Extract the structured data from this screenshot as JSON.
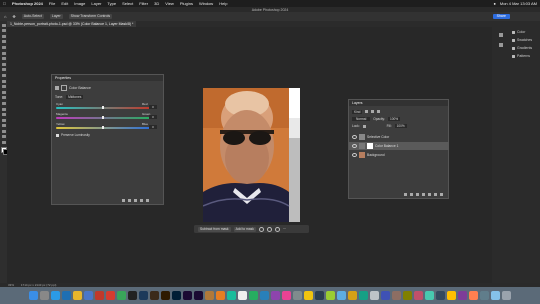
{
  "menubar": {
    "app": "Photoshop 2024",
    "items": [
      "File",
      "Edit",
      "Image",
      "Layer",
      "Type",
      "Select",
      "Filter",
      "3D",
      "View",
      "Plugins",
      "Window",
      "Help"
    ],
    "datetime": "Mon 4 Mar 13:03 AM"
  },
  "window": {
    "title": "Adobe Photoshop 2024"
  },
  "options": {
    "auto_select": "Auto-Select",
    "layer": "Layer",
    "show_transform": "Show Transform Controls",
    "share": "Share"
  },
  "document": {
    "tab": "1_Noble-person_portrait-photo-1.psd @ 33% (Color Balance 1, Layer Mask/8) *"
  },
  "dock_right": {
    "items": [
      "Color",
      "Swatches",
      "Gradients",
      "Patterns"
    ]
  },
  "properties": {
    "title": "Properties",
    "subtitle": "Color Balance",
    "tone_label": "Tone:",
    "tone_value": "Midtones",
    "sliders": [
      {
        "left": "Cyan",
        "right": "Red",
        "value": "0",
        "pos": 0.5,
        "color": "#c0392b"
      },
      {
        "left": "Magenta",
        "right": "Green",
        "value": "0",
        "pos": 0.5,
        "color": "#27ae60"
      },
      {
        "left": "Yellow",
        "right": "Blue",
        "value": "0",
        "pos": 0.5,
        "color": "#2e6fd8"
      }
    ],
    "preserve": "Preserve Luminosity"
  },
  "context": {
    "subtract": "Subtract from mask",
    "add": "Add to mask"
  },
  "layers": {
    "title": "Layers",
    "kind": "Kind",
    "blend": "Normal",
    "opacity_label": "Opacity:",
    "opacity": "100%",
    "lock_label": "Lock:",
    "fill_label": "Fill:",
    "fill": "100%",
    "rows": [
      {
        "name": "Selective Color"
      },
      {
        "name": "Color Balance 1"
      },
      {
        "name": "Background"
      }
    ]
  },
  "status": {
    "zoom": "33%",
    "info": "1714 px x 2143 px (72 ppi)"
  }
}
